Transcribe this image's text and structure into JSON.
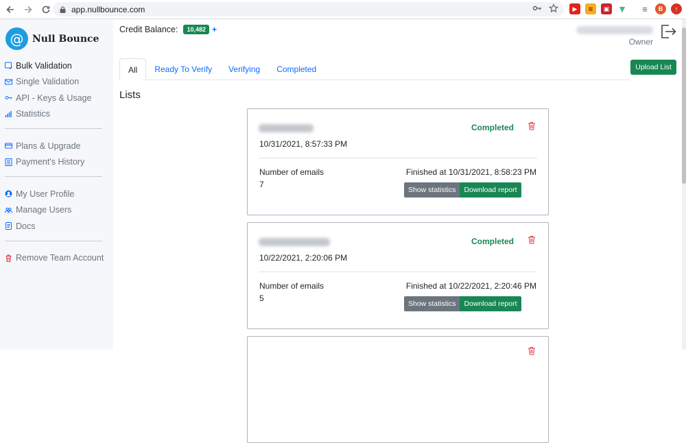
{
  "browser": {
    "url": "app.nullbounce.com"
  },
  "app": {
    "logo_symbol": "@",
    "name": "Null Bounce"
  },
  "sidebar": {
    "items": [
      {
        "label": "Bulk Validation",
        "icon": "bulk-icon"
      },
      {
        "label": "Single Validation",
        "icon": "envelope-icon"
      },
      {
        "label": "API - Keys & Usage",
        "icon": "key-icon"
      },
      {
        "label": "Statistics",
        "icon": "bar-chart-icon"
      },
      {
        "label": "Plans & Upgrade",
        "icon": "card-icon"
      },
      {
        "label": "Payment's History",
        "icon": "receipt-icon"
      },
      {
        "label": "My User Profile",
        "icon": "user-circle-icon"
      },
      {
        "label": "Manage Users",
        "icon": "users-icon"
      },
      {
        "label": "Docs",
        "icon": "doc-icon"
      },
      {
        "label": "Remove Team Account",
        "icon": "trash-icon"
      }
    ]
  },
  "header": {
    "credit_label": "Credit Balance:",
    "credit_value": "10,482",
    "credit_add": "+",
    "role": "Owner",
    "upload_label": "Upload List"
  },
  "tabs": [
    {
      "label": "All",
      "active": true
    },
    {
      "label": "Ready To Verify",
      "active": false
    },
    {
      "label": "Verifying",
      "active": false
    },
    {
      "label": "Completed",
      "active": false
    }
  ],
  "lists_title": "Lists",
  "lists": [
    {
      "status": "Completed",
      "created": "10/31/2021, 8:57:33 PM",
      "emails_label": "Number of emails",
      "emails_count": "7",
      "finished": "Finished at 10/31/2021, 8:58:23 PM",
      "stats_label": "Show statistics",
      "download_label": "Download report"
    },
    {
      "status": "Completed",
      "created": "10/22/2021, 2:20:06 PM",
      "emails_label": "Number of emails",
      "emails_count": "5",
      "finished": "Finished at 10/22/2021, 2:20:46 PM",
      "stats_label": "Show statistics",
      "download_label": "Download report"
    }
  ],
  "colors": {
    "accent_green": "#198754",
    "link_blue": "#0d6efd",
    "logo_blue": "#1e9ce0",
    "danger": "#dc3545"
  }
}
